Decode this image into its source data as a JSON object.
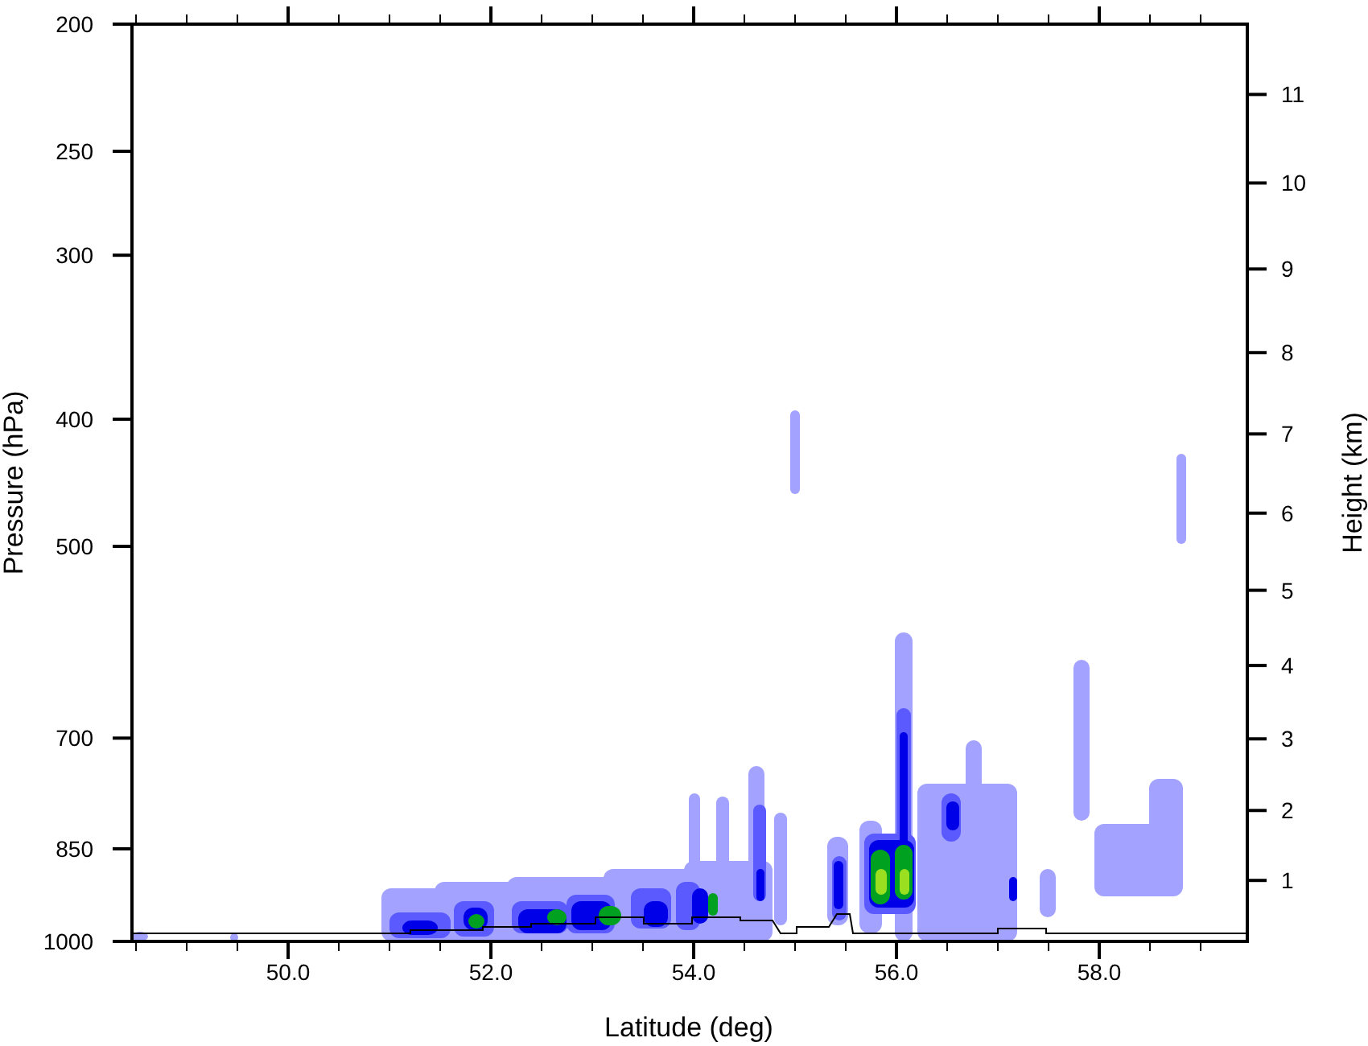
{
  "plot": {
    "xlabel": "Latitude (deg)",
    "ylabel": "Pressure (hPa)",
    "ylabel_right": "Height (km)",
    "x_ticks": [
      "50.0",
      "52.0",
      "54.0",
      "56.0",
      "58.0"
    ],
    "y_ticks": [
      "200",
      "250",
      "300",
      "400",
      "500",
      "700",
      "850",
      "1000"
    ],
    "right_ticks": [
      "11",
      "10",
      "9",
      "8",
      "7",
      "6",
      "5",
      "4",
      "3",
      "2",
      "1"
    ]
  }
}
